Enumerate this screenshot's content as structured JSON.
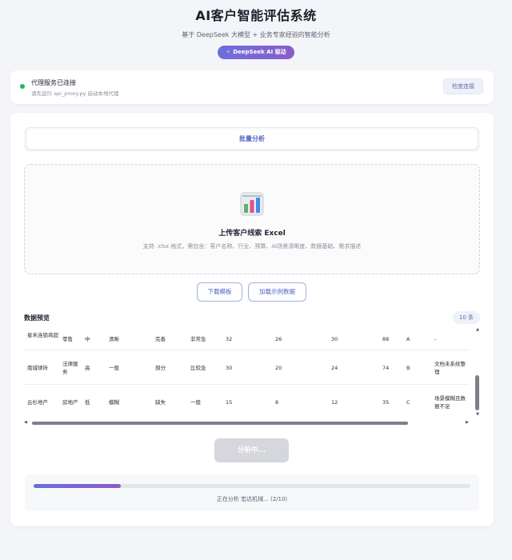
{
  "header": {
    "title": "AI客户智能评估系统",
    "subtitle": "基于 DeepSeek 大模型 + 业务专家经验的智能分析",
    "badge": "DeepSeek AI 驱动"
  },
  "proxy": {
    "status_title": "代理服务已连接",
    "status_sub": "请先运行 api_proxy.py 启动本地代理",
    "check_button": "检查连接",
    "status_color": "#27b35a"
  },
  "tabs": [
    {
      "label": "批量分析",
      "active": true
    }
  ],
  "upload": {
    "icon": "bar-chart-icon",
    "title": "上传客户线索 Excel",
    "hint": "支持 .xlsx 格式，需包含：客户名称、行业、预算、AI场景清晰度、数据基础、需求描述"
  },
  "actions": {
    "download_template": "下载模板",
    "load_sample": "加载示例数据"
  },
  "preview": {
    "title": "数据预览",
    "count": "10 条",
    "rows": [
      [
        "星禾连锁商超",
        "零售",
        "中",
        "清晰",
        "完善",
        "非常急",
        "32",
        "26",
        "30",
        "88",
        "A",
        "-"
      ],
      [
        "南城律所",
        "法律服务",
        "高",
        "一般",
        "部分",
        "比较急",
        "30",
        "20",
        "24",
        "74",
        "B",
        "文档未系统整理"
      ],
      [
        "云杉地产",
        "房地产",
        "低",
        "模糊",
        "缺失",
        "一般",
        "15",
        "8",
        "12",
        "35",
        "C",
        "场景模糊且数据不足"
      ]
    ]
  },
  "analyze_button": "分析中...",
  "progress": {
    "value": 0.2,
    "text": "正在分析 宏达机械... (2/10)"
  },
  "colors": {
    "accent": "#4f63c4",
    "gradient_start": "#6b6fdc",
    "gradient_end": "#8b5dc9"
  }
}
